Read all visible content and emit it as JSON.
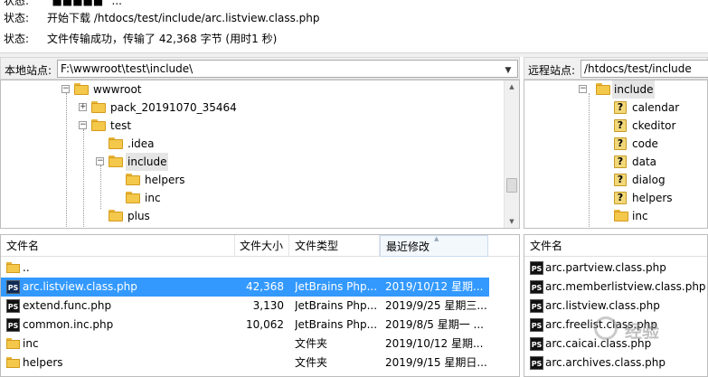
{
  "log": [
    {
      "label": "状态:",
      "text": "\"■■■■■\" ..."
    },
    {
      "label": "状态:",
      "text": "开始下载 /htdocs/test/include/arc.listview.class.php"
    },
    {
      "label": "状态:",
      "text": "文件传输成功，传输了 42,368 字节 (用时1 秒)"
    }
  ],
  "local": {
    "label": "本地站点:",
    "path": "F:\\wwwroot\\test\\include\\",
    "tree": [
      {
        "label": "wwwroot",
        "icon": "folder-icon",
        "expander": "minus"
      },
      {
        "label": "pack_20191070_35464",
        "icon": "folder-icon",
        "expander": "plus"
      },
      {
        "label": "test",
        "icon": "folder-icon",
        "expander": "minus"
      },
      {
        "label": ".idea",
        "icon": "folder-icon",
        "expander": ""
      },
      {
        "label": "include",
        "icon": "folder-icon",
        "expander": "minus",
        "selected": true
      },
      {
        "label": "helpers",
        "icon": "folder-icon",
        "expander": ""
      },
      {
        "label": "inc",
        "icon": "folder-icon",
        "expander": ""
      },
      {
        "label": "plus",
        "icon": "folder-icon",
        "expander": ""
      }
    ],
    "columns": [
      "文件名",
      "文件大小",
      "文件类型",
      "最近修改"
    ],
    "files": [
      {
        "name": "..",
        "size": "",
        "type": "",
        "modified": "",
        "icon": "folder-icon"
      },
      {
        "name": "arc.listview.class.php",
        "size": "42,368",
        "type": "JetBrains Php...",
        "modified": "2019/10/12 星期...",
        "icon": "php-file-icon",
        "selected": true
      },
      {
        "name": "extend.func.php",
        "size": "3,130",
        "type": "JetBrains Php...",
        "modified": "2019/9/25 星期三...",
        "icon": "php-file-icon"
      },
      {
        "name": "common.inc.php",
        "size": "10,062",
        "type": "JetBrains Php...",
        "modified": "2019/8/5 星期一 ...",
        "icon": "php-file-icon"
      },
      {
        "name": "inc",
        "size": "",
        "type": "文件夹",
        "modified": "2019/10/12 星期...",
        "icon": "folder-icon"
      },
      {
        "name": "helpers",
        "size": "",
        "type": "文件夹",
        "modified": "2019/9/15 星期日...",
        "icon": "folder-icon"
      }
    ]
  },
  "remote": {
    "label": "远程站点:",
    "path": "/htdocs/test/include",
    "tree": [
      {
        "label": "include",
        "icon": "folder-icon",
        "expander": "minus",
        "selected": true
      },
      {
        "label": "calendar",
        "icon": "unknown-folder-icon",
        "expander": ""
      },
      {
        "label": "ckeditor",
        "icon": "unknown-folder-icon",
        "expander": ""
      },
      {
        "label": "code",
        "icon": "unknown-folder-icon",
        "expander": ""
      },
      {
        "label": "data",
        "icon": "unknown-folder-icon",
        "expander": ""
      },
      {
        "label": "dialog",
        "icon": "unknown-folder-icon",
        "expander": ""
      },
      {
        "label": "helpers",
        "icon": "unknown-folder-icon",
        "expander": ""
      },
      {
        "label": "inc",
        "icon": "folder-icon",
        "expander": ""
      }
    ],
    "columns": [
      "文件名"
    ],
    "files": [
      {
        "name": "arc.partview.class.php",
        "icon": "php-file-icon"
      },
      {
        "name": "arc.memberlistview.class.php",
        "icon": "php-file-icon"
      },
      {
        "name": "arc.listview.class.php",
        "icon": "php-file-icon"
      },
      {
        "name": "arc.freelist.class.php",
        "icon": "php-file-icon"
      },
      {
        "name": "arc.caicai.class.php",
        "icon": "php-file-icon"
      },
      {
        "name": "arc.archives.class.php",
        "icon": "php-file-icon"
      }
    ]
  },
  "icons": {
    "ps": "PS",
    "unknown": "?"
  },
  "watermark": "经验"
}
